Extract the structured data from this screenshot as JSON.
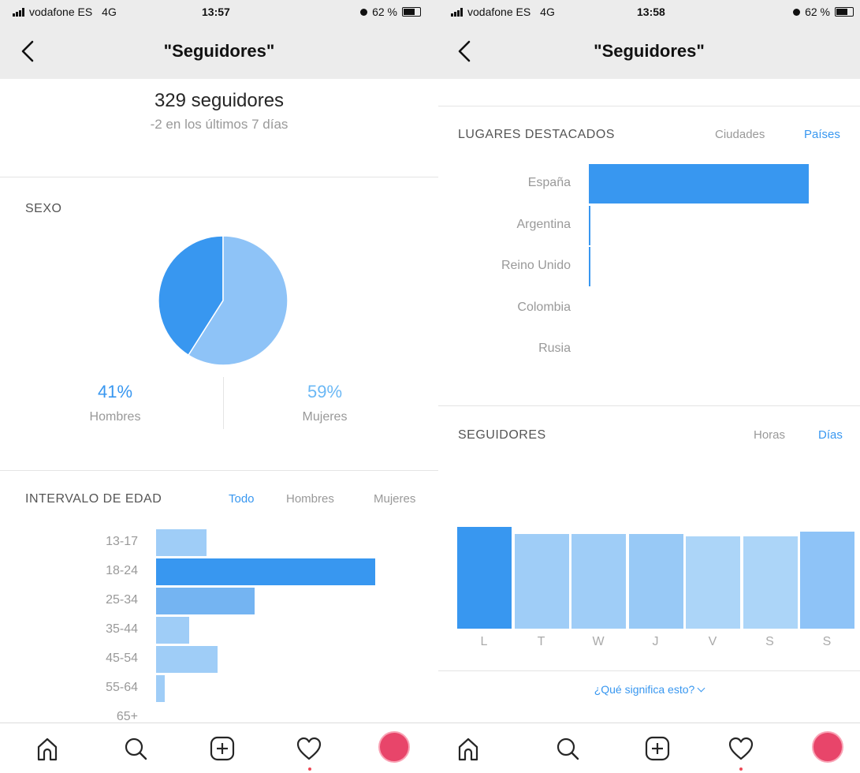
{
  "left": {
    "status": {
      "carrier": "vodafone ES",
      "network": "4G",
      "time": "13:57",
      "battery": "62 %"
    },
    "header": {
      "title": "\"Seguidores\""
    },
    "summary": {
      "count": "329 seguidores",
      "delta": "-2 en los últimos 7 días"
    },
    "gender": {
      "label": "SEXO",
      "men": {
        "percent": "41%",
        "label": "Hombres"
      },
      "women": {
        "percent": "59%",
        "label": "Mujeres"
      }
    },
    "age": {
      "label": "INTERVALO DE EDAD",
      "filters": [
        "Todo",
        "Hombres",
        "Mujeres"
      ],
      "active_filter": "Todo",
      "ranges": [
        "13-17",
        "18-24",
        "25-34",
        "35-44",
        "45-54",
        "55-64",
        "65+"
      ]
    }
  },
  "right": {
    "status": {
      "carrier": "vodafone ES",
      "network": "4G",
      "time": "13:58",
      "battery": "62 %"
    },
    "header": {
      "title": "\"Seguidores\""
    },
    "places": {
      "label": "LUGARES DESTACADOS",
      "filters": [
        "Ciudades",
        "Países"
      ],
      "active_filter": "Países",
      "countries": [
        "España",
        "Argentina",
        "Reino Unido",
        "Colombia",
        "Rusia"
      ]
    },
    "followers": {
      "label": "SEGUIDORES",
      "filters": [
        "Horas",
        "Días"
      ],
      "active_filter": "Días",
      "days": [
        "L",
        "T",
        "W",
        "J",
        "V",
        "S",
        "S"
      ]
    },
    "help": {
      "label": "¿Qué significa esto?"
    }
  },
  "tabs": [
    "home-icon",
    "search-icon",
    "add-post-icon",
    "activity-heart-icon",
    "profile-avatar"
  ],
  "colors": {
    "accent": "#3897f0",
    "bar_dark": "#3897f0",
    "bar_mid": "#74b4f2",
    "bar_light": "#9fcdf7",
    "avatar": "#e8456a"
  },
  "chart_data": [
    {
      "type": "pie",
      "title": "SEXO",
      "categories": [
        "Hombres",
        "Mujeres"
      ],
      "values": [
        41,
        59
      ],
      "colors": [
        "#3897f0",
        "#8ec3f7"
      ]
    },
    {
      "type": "bar",
      "orientation": "horizontal",
      "title": "INTERVALO DE EDAD",
      "categories": [
        "13-17",
        "18-24",
        "25-34",
        "35-44",
        "45-54",
        "55-64",
        "65+"
      ],
      "values": [
        23,
        100,
        45,
        15,
        28,
        4,
        0
      ]
    },
    {
      "type": "bar",
      "orientation": "horizontal",
      "title": "LUGARES DESTACADOS",
      "categories": [
        "España",
        "Argentina",
        "Reino Unido",
        "Colombia",
        "Rusia"
      ],
      "values": [
        100,
        0.6,
        0.6,
        0,
        0
      ]
    },
    {
      "type": "bar",
      "title": "SEGUIDORES",
      "categories": [
        "L",
        "T",
        "W",
        "J",
        "V",
        "S",
        "S"
      ],
      "values": [
        100,
        93,
        93,
        93,
        91,
        91,
        95
      ]
    }
  ]
}
